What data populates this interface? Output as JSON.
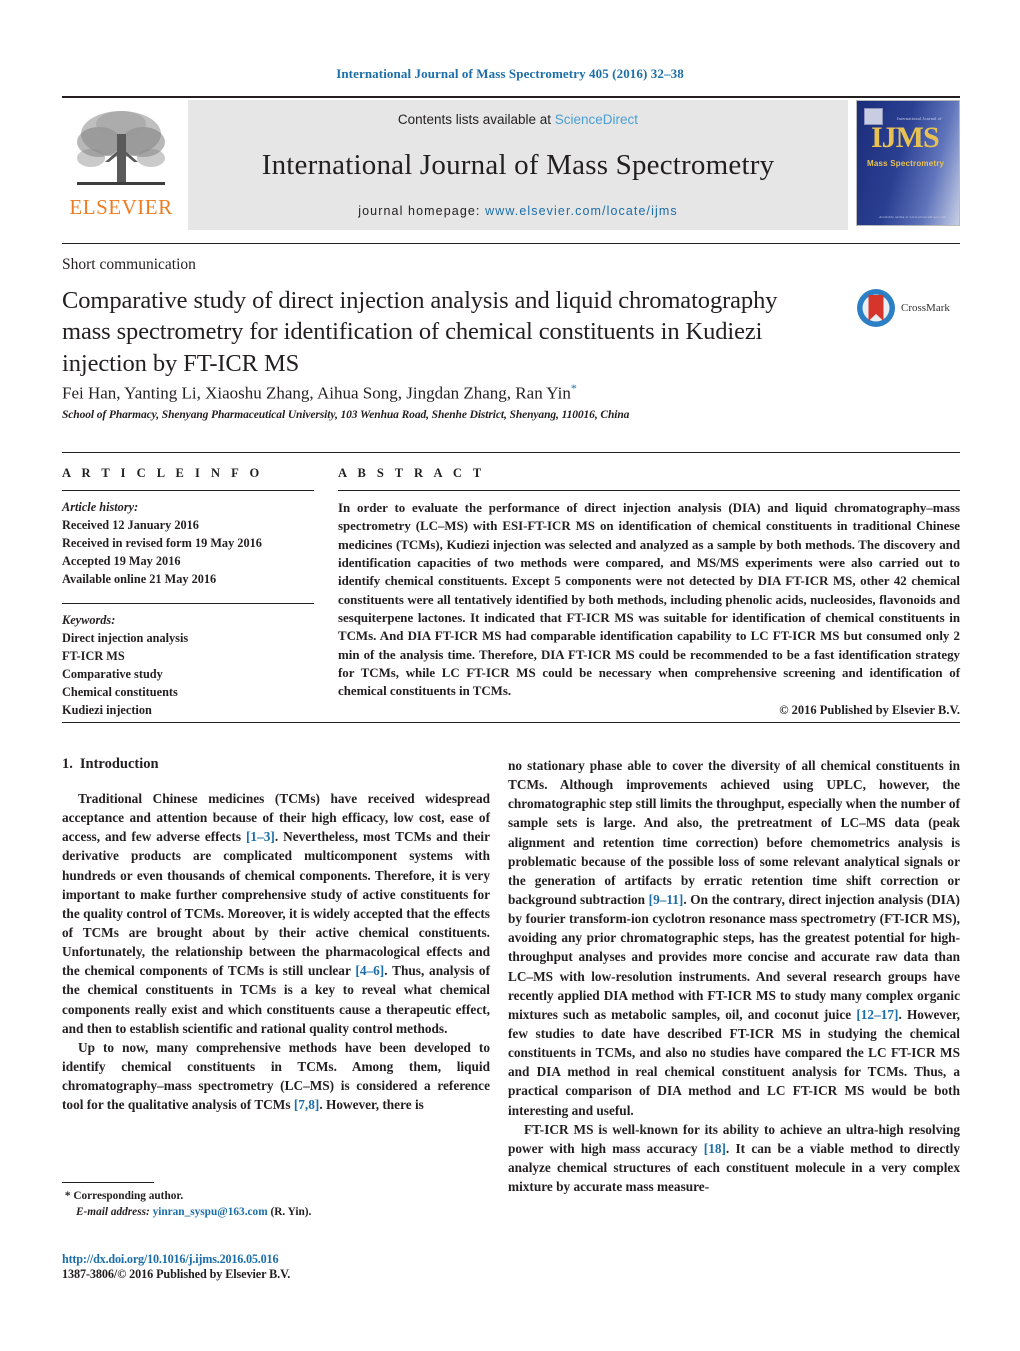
{
  "running_head": "International Journal of Mass Spectrometry 405 (2016) 32–38",
  "masthead": {
    "publisher_name": "ELSEVIER",
    "contents_prefix": "Contents lists available at",
    "contents_link": "ScienceDirect",
    "journal_title": "International Journal of Mass Spectrometry",
    "homepage_prefix": "journal homepage:",
    "homepage_url": "www.elsevier.com/locate/ijms",
    "cover": {
      "acronym": "IJMS",
      "top_caption": "International Journal of",
      "subtitle": "Mass Spectrometry",
      "bottom_caption": "Available online at www.sciencedirect.com"
    }
  },
  "article": {
    "doctype": "Short communication",
    "title": "Comparative study of direct injection analysis and liquid chromatography mass spectrometry for identification of chemical constituents in Kudiezi injection by FT-ICR MS",
    "authors": "Fei Han, Yanting Li, Xiaoshu Zhang, Aihua Song, Jingdan Zhang, Ran Yin",
    "corresponding_marker": "*",
    "affiliation": "School of Pharmacy, Shenyang Pharmaceutical University, 103 Wenhua Road, Shenhe District, Shenyang, 110016, China",
    "crossmark_label": "CrossMark"
  },
  "article_info": {
    "heading": "A R T I C L E    I N F O",
    "history_label": "Article history:",
    "history": [
      "Received 12 January 2016",
      "Received in revised form 19 May 2016",
      "Accepted 19 May 2016",
      "Available online 21 May 2016"
    ],
    "keywords_label": "Keywords:",
    "keywords": [
      "Direct injection analysis",
      "FT-ICR MS",
      "Comparative study",
      "Chemical constituents",
      "Kudiezi injection"
    ]
  },
  "abstract": {
    "heading": "A B S T R A C T",
    "text": "In order to evaluate the performance of direct injection analysis (DIA) and liquid chromatography–mass spectrometry (LC–MS) with ESI-FT-ICR MS on identification of chemical constituents in traditional Chinese medicines (TCMs), Kudiezi injection was selected and analyzed as a sample by both methods. The discovery and identification capacities of two methods were compared, and MS/MS experiments were also carried out to identify chemical constituents. Except 5 components were not detected by DIA FT-ICR MS, other 42 chemical constituents were all tentatively identified by both methods, including phenolic acids, nucleosides, flavonoids and sesquiterpene lactones. It indicated that FT-ICR MS was suitable for identification of chemical constituents in TCMs. And DIA FT-ICR MS had comparable identification capability to LC FT-ICR MS but consumed only 2 min of the analysis time. Therefore, DIA FT-ICR MS could be recommended to be a fast identification strategy for TCMs, while LC FT-ICR MS could be necessary when comprehensive screening and identification of chemical constituents in TCMs.",
    "copyright": "© 2016 Published by Elsevier B.V."
  },
  "introduction": {
    "number": "1.",
    "title": "Introduction",
    "left_paragraphs": [
      "Traditional Chinese medicines (TCMs) have received widespread acceptance and attention because of their high efficacy, low cost, ease of access, and few adverse effects [1–3]. Nevertheless, most TCMs and their derivative products are complicated multicomponent systems with hundreds or even thousands of chemical components. Therefore, it is very important to make further comprehensive study of active constituents for the quality control of TCMs. Moreover, it is widely accepted that the effects of TCMs are brought about by their active chemical constituents. Unfortunately, the relationship between the pharmacological effects and the chemical components of TCMs is still unclear [4–6]. Thus, analysis of the chemical constituents in TCMs is a key to reveal what chemical components really exist and which constituents cause a therapeutic effect, and then to establish scientific and rational quality control methods.",
      "Up to now, many comprehensive methods have been developed to identify chemical constituents in TCMs. Among them, liquid chromatography–mass spectrometry (LC–MS) is considered a reference tool for the qualitative analysis of TCMs [7,8]. However, there is"
    ],
    "right_paragraphs": [
      "no stationary phase able to cover the diversity of all chemical constituents in TCMs. Although improvements achieved using UPLC, however, the chromatographic step still limits the throughput, especially when the number of sample sets is large. And also, the pretreatment of LC–MS data (peak alignment and retention time correction) before chemometrics analysis is problematic because of the possible loss of some relevant analytical signals or the generation of artifacts by erratic retention time shift correction or background subtraction [9–11]. On the contrary, direct injection analysis (DIA) by fourier transform-ion cyclotron resonance mass spectrometry (FT-ICR MS), avoiding any prior chromatographic steps, has the greatest potential for high-throughput analyses and provides more concise and accurate raw data than LC–MS with low-resolution instruments. And several research groups have recently applied DIA method with FT-ICR MS to study many complex organic mixtures such as metabolic samples, oil, and coconut juice [12–17]. However, few studies to date have described FT-ICR MS in studying the chemical constituents in TCMs, and also no studies have compared the LC FT-ICR MS and DIA method in real chemical constituent analysis for TCMs. Thus, a practical comparison of DIA method and LC FT-ICR MS would be both interesting and useful.",
      "FT-ICR MS is well-known for its ability to achieve an ultra-high resolving power with high mass accuracy [18]. It can be a viable method to directly analyze chemical structures of each constituent molecule in a very complex mixture by accurate mass measure-"
    ],
    "citations": [
      "[1–3]",
      "[4–6]",
      "[7,8]",
      "[9–11]",
      "[12–17]",
      "[18]"
    ]
  },
  "footnotes": {
    "corresponding_marker": "*",
    "corresponding_label": "Corresponding author.",
    "email_label": "E-mail address:",
    "email": "yinran_syspu@163.com",
    "email_owner": "(R. Yin).",
    "doi": "http://dx.doi.org/10.1016/j.ijms.2016.05.016",
    "issn_copyright": "1387-3806/© 2016 Published by Elsevier B.V."
  },
  "colors": {
    "link_blue": "#1b6ea8",
    "sciencedirect_blue": "#4a9fd4",
    "elsevier_orange": "#ec7d23",
    "band_gray": "#e6e6e6"
  }
}
